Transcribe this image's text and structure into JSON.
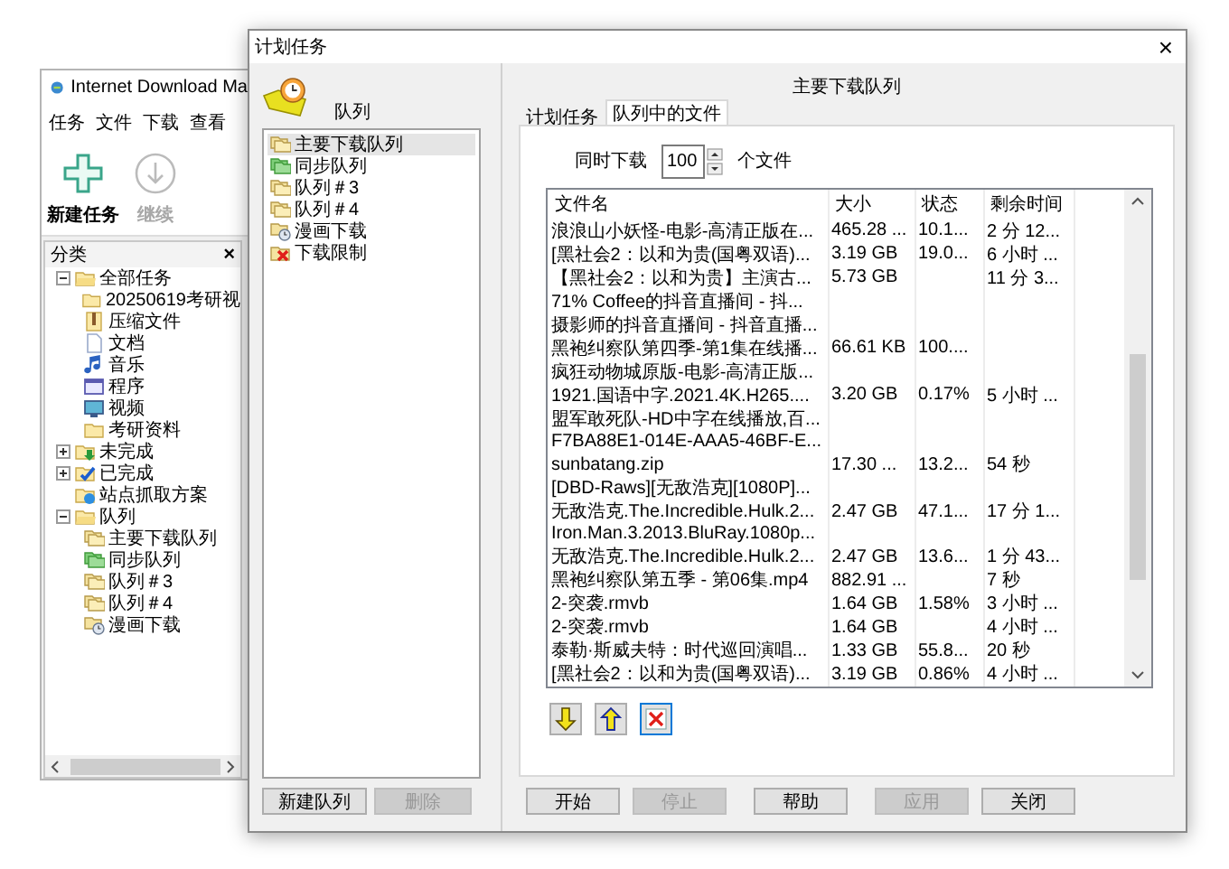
{
  "back_window": {
    "title": "Internet Download Ma",
    "menu": [
      "任务",
      "文件",
      "下载",
      "查看"
    ],
    "toolbar": [
      {
        "label": "新建任务",
        "kind": "add",
        "disabled": false
      },
      {
        "label": "继续",
        "kind": "resume",
        "disabled": true
      }
    ],
    "categories": {
      "title": "分类",
      "close": "×",
      "items": [
        {
          "label": "全部任务",
          "kind": "folder-open",
          "expanded": true,
          "children": [
            {
              "label": "20250619考研视",
              "kind": "folder"
            },
            {
              "label": "压缩文件",
              "kind": "zip"
            },
            {
              "label": "文档",
              "kind": "doc"
            },
            {
              "label": "音乐",
              "kind": "music"
            },
            {
              "label": "程序",
              "kind": "program"
            },
            {
              "label": "视频",
              "kind": "video"
            },
            {
              "label": "考研资料",
              "kind": "folder"
            }
          ]
        },
        {
          "label": "未完成",
          "kind": "incomplete",
          "expanded": false
        },
        {
          "label": "已完成",
          "kind": "complete",
          "expanded": false
        },
        {
          "label": "站点抓取方案",
          "kind": "site"
        },
        {
          "label": "队列",
          "kind": "folder-open",
          "expanded": true,
          "children": [
            {
              "label": "主要下载队列",
              "kind": "queue"
            },
            {
              "label": "同步队列",
              "kind": "queue-green"
            },
            {
              "label": "队列＃3",
              "kind": "queue"
            },
            {
              "label": "队列＃4",
              "kind": "queue"
            },
            {
              "label": "漫画下载",
              "kind": "queue-clock"
            }
          ]
        }
      ]
    }
  },
  "dialog": {
    "title": "计划任务",
    "close": "×",
    "queues_label": "队列",
    "queues": [
      {
        "label": "主要下载队列",
        "kind": "queue",
        "selected": true
      },
      {
        "label": "同步队列",
        "kind": "queue-green",
        "selected": false
      },
      {
        "label": "队列＃3",
        "kind": "queue",
        "selected": false
      },
      {
        "label": "队列＃4",
        "kind": "queue",
        "selected": false
      },
      {
        "label": "漫画下载",
        "kind": "queue-clock",
        "selected": false
      },
      {
        "label": "下载限制",
        "kind": "limit",
        "selected": false
      }
    ],
    "queue_buttons": [
      {
        "label": "新建队列",
        "disabled": false
      },
      {
        "label": "删除",
        "disabled": true
      }
    ],
    "queue_title": "主要下载队列",
    "tabs": [
      {
        "label": "计划任务",
        "selected": false
      },
      {
        "label": "队列中的文件",
        "selected": true
      }
    ],
    "concurrent": {
      "label": "同时下载",
      "value": "100",
      "unit": "个文件"
    },
    "table": {
      "columns": [
        "文件名",
        "大小",
        "状态",
        "剩余时间"
      ],
      "rows": [
        [
          "浪浪山小妖怪-电影-高清正版在...",
          "465.28 ...",
          "10.1...",
          "2 分 12..."
        ],
        [
          "[黑社会2：以和为贵(国粤双语)...",
          "3.19 GB",
          "19.0...",
          "6 小时 ..."
        ],
        [
          "【黑社会2：以和为贵】主演古...",
          "5.73 GB",
          "",
          "11 分 3..."
        ],
        [
          "71% Coffee的抖音直播间 - 抖...",
          "",
          "",
          ""
        ],
        [
          "摄影师的抖音直播间 - 抖音直播...",
          "",
          "",
          ""
        ],
        [
          "黑袍纠察队第四季-第1集在线播...",
          "66.61 KB",
          "100....",
          ""
        ],
        [
          "疯狂动物城原版-电影-高清正版...",
          "",
          "",
          ""
        ],
        [
          "1921.国语中字.2021.4K.H265....",
          "3.20 GB",
          "0.17%",
          "5 小时 ..."
        ],
        [
          "盟军敢死队-HD中字在线播放,百...",
          "",
          "",
          ""
        ],
        [
          "F7BA88E1-014E-AAA5-46BF-E...",
          "",
          "",
          ""
        ],
        [
          "sunbatang.zip",
          "17.30 ...",
          "13.2...",
          "54 秒"
        ],
        [
          "[DBD-Raws][无敌浩克][1080P]...",
          "",
          "",
          ""
        ],
        [
          "无敌浩克.The.Incredible.Hulk.2...",
          "2.47 GB",
          "47.1...",
          "17 分 1..."
        ],
        [
          "Iron.Man.3.2013.BluRay.1080p...",
          "",
          "",
          ""
        ],
        [
          "无敌浩克.The.Incredible.Hulk.2...",
          "2.47 GB",
          "13.6...",
          "1 分 43..."
        ],
        [
          "黑袍纠察队第五季 - 第06集.mp4",
          "882.91 ...",
          "",
          "7 秒"
        ],
        [
          "2-突袭.rmvb",
          "1.64 GB",
          "1.58%",
          "3 小时 ..."
        ],
        [
          "2-突袭.rmvb",
          "1.64 GB",
          "",
          "4 小时 ..."
        ],
        [
          "泰勒·斯威夫特：时代巡回演唱...",
          "1.33 GB",
          "55.8...",
          "20 秒"
        ],
        [
          "[黑社会2：以和为贵(国粤双语)...",
          "3.19 GB",
          "0.86%",
          "4 小时 ..."
        ]
      ]
    },
    "icon_buttons": [
      {
        "kind": "move-down",
        "focused": false
      },
      {
        "kind": "move-up",
        "focused": false
      },
      {
        "kind": "delete",
        "focused": true
      }
    ],
    "buttons": [
      {
        "label": "开始",
        "disabled": false
      },
      {
        "label": "停止",
        "disabled": true
      },
      {
        "label": "帮助",
        "disabled": false
      },
      {
        "label": "应用",
        "disabled": true
      },
      {
        "label": "关闭",
        "disabled": false
      }
    ]
  }
}
